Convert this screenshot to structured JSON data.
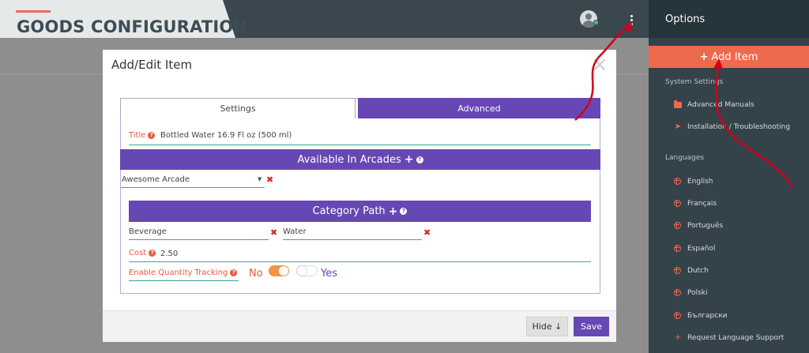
{
  "header": {
    "title": "GOODS CONFIGURATION"
  },
  "sidebar": {
    "title": "Options",
    "add_item": "Add Item",
    "system_settings": "System Settings",
    "system_items": [
      {
        "label": "Advanced Manuals",
        "icon": "folder-icon"
      },
      {
        "label": "Installation / Troubleshooting",
        "icon": "paper-plane-icon"
      }
    ],
    "languages_label": "Languages",
    "languages": [
      "English",
      "Français",
      "Português",
      "Español",
      "Dutch",
      "Polski",
      "Български"
    ],
    "request_support": "Request Language Support"
  },
  "modal": {
    "title": "Add/Edit Item",
    "close": "×",
    "tabs": {
      "settings": "Settings",
      "advanced": "Advanced"
    },
    "title_label": "Title",
    "title_value": "Bottled Water 16.9 Fl oz (500 ml)",
    "arcades_header": "Available In Arcades",
    "arcade_value": "Awesome Arcade",
    "category_header": "Category Path",
    "category_values": [
      "Beverage",
      "Water"
    ],
    "cost_label": "Cost",
    "cost_value": "2.50",
    "quantity_label": "Enable Quantity Tracking",
    "no_label": "No",
    "yes_label": "Yes",
    "hide_button": "Hide ↓",
    "save_button": "Save"
  },
  "colors": {
    "accent": "#ee6a4d",
    "purple": "#6747b3",
    "teal": "#3aa88f",
    "sidebar": "#34424a",
    "annotation": "#d0021b"
  }
}
